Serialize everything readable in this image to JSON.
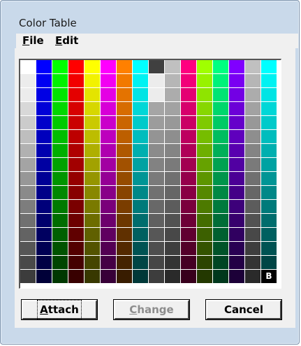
{
  "window": {
    "title": "Color Table"
  },
  "menu": [
    {
      "accel": "F",
      "rest": "ile"
    },
    {
      "accel": "E",
      "rest": "dit"
    }
  ],
  "palette": {
    "columns": 16,
    "rows": 16,
    "badge_label": "B",
    "column_hues": [
      [
        "#ffffff",
        "#0000ff",
        "#00ff00",
        "#ff0000",
        "#ffff00",
        "#ff00ff",
        "#ff8000",
        "#00ffff",
        "#404040",
        "#c0c0c0",
        "#ff0080",
        "#a0ff00",
        "#00ff80",
        "#8000ff",
        "#c0c0c0",
        "#00ffff"
      ]
    ]
  },
  "buttons": {
    "attach": {
      "accel": "A",
      "rest": "ttach"
    },
    "change": {
      "accel": "C",
      "rest": "hange"
    },
    "cancel": {
      "label": "Cancel"
    }
  }
}
